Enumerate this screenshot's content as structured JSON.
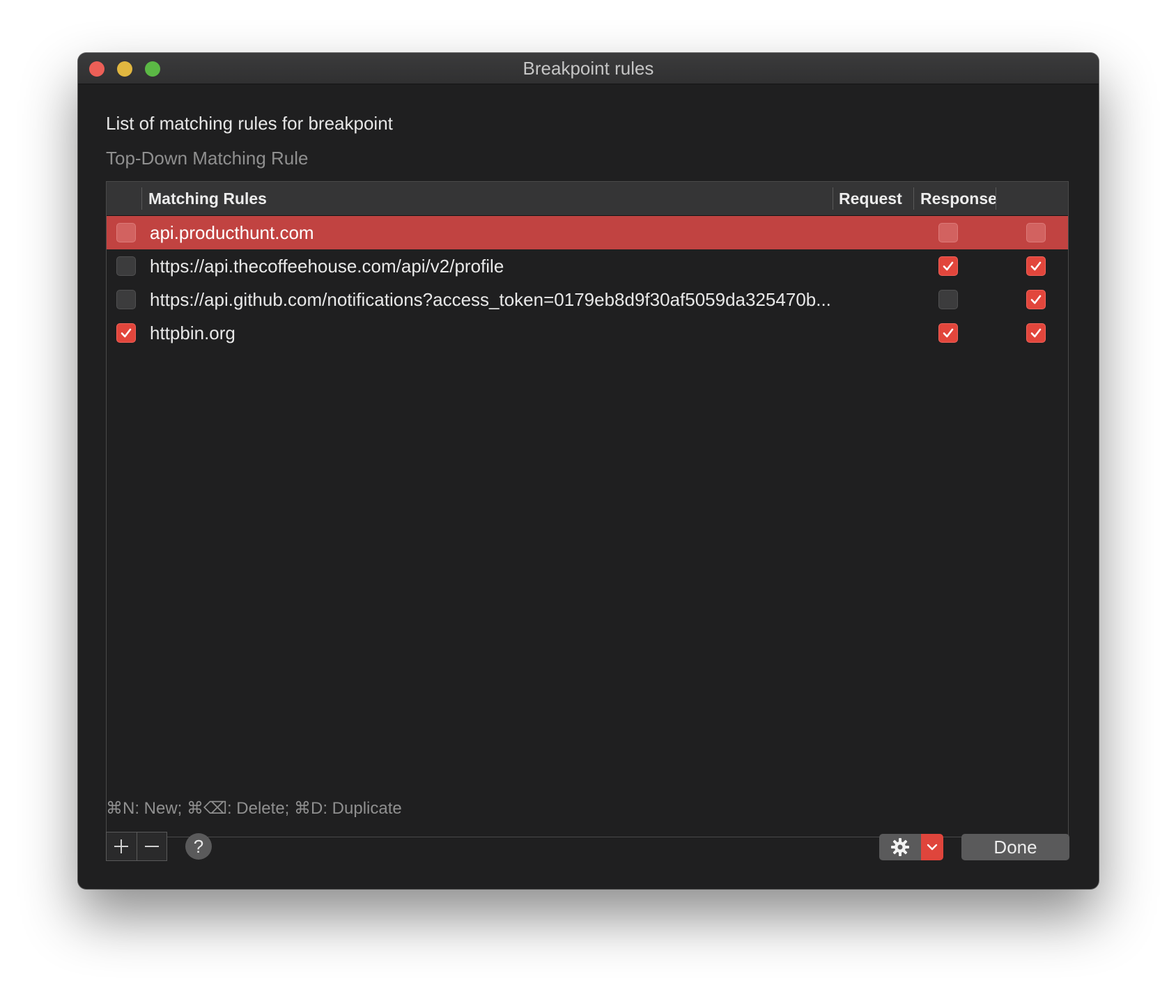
{
  "window": {
    "title": "Breakpoint rules"
  },
  "content": {
    "heading": "List of matching rules for breakpoint",
    "subheading": "Top-Down Matching Rule",
    "shortcuts_hint": "⌘N: New; ⌘⌫: Delete; ⌘D: Duplicate"
  },
  "table": {
    "columns": {
      "rules": "Matching Rules",
      "request": "Request",
      "response": "Response"
    },
    "rows": [
      {
        "label": "api.producthunt.com",
        "enabled": false,
        "request": false,
        "response": false,
        "selected": true
      },
      {
        "label": "https://api.thecoffeehouse.com/api/v2/profile",
        "enabled": false,
        "request": true,
        "response": true,
        "selected": false
      },
      {
        "label": "https://api.github.com/notifications?access_token=0179eb8d9f30af5059da325470b...",
        "enabled": false,
        "request": false,
        "response": true,
        "selected": false
      },
      {
        "label": "httpbin.org",
        "enabled": true,
        "request": true,
        "response": true,
        "selected": false
      }
    ]
  },
  "footer": {
    "add_label": "+",
    "remove_label": "−",
    "help_label": "?",
    "done_label": "Done"
  },
  "colors": {
    "accent": "#e2463c",
    "selection": "#c14341",
    "background": "#1f1f20"
  },
  "icons": {
    "gear": "gear-icon",
    "chevron": "chevron-down-icon",
    "check": "checkmark-icon"
  }
}
